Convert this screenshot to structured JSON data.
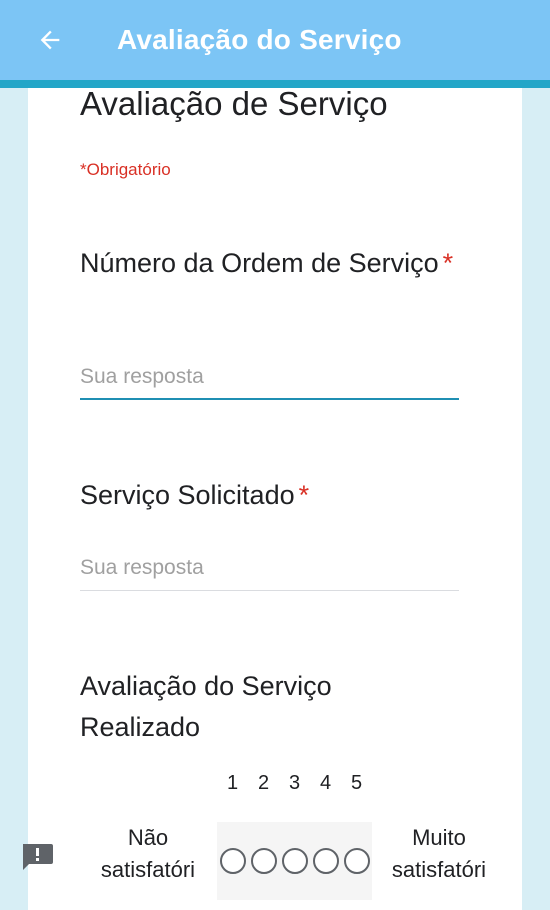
{
  "app_bar": {
    "title": "Avaliação do Serviço",
    "back_icon": "arrow-left-icon"
  },
  "form": {
    "title": "Avaliação de Serviço",
    "required_note": "*Obrigatório",
    "questions": [
      {
        "label": "Número da Ordem de Serviço",
        "required_mark": "*",
        "placeholder": "Sua resposta",
        "value": ""
      },
      {
        "label": "Serviço Solicitado",
        "required_mark": "*",
        "placeholder": "Sua resposta",
        "value": ""
      },
      {
        "label": "Avaliação do Serviço Realizado",
        "scale": {
          "numbers": [
            "1",
            "2",
            "3",
            "4",
            "5"
          ],
          "low_label": "Não satisfatóri",
          "high_label": "Muito satisfatóri"
        }
      }
    ]
  },
  "feedback_icon": "report-feedback-icon",
  "colors": {
    "app_bar": "#7cc5f5",
    "accent": "#23a6c8",
    "required": "#d93025",
    "background": "#d7eef5"
  }
}
